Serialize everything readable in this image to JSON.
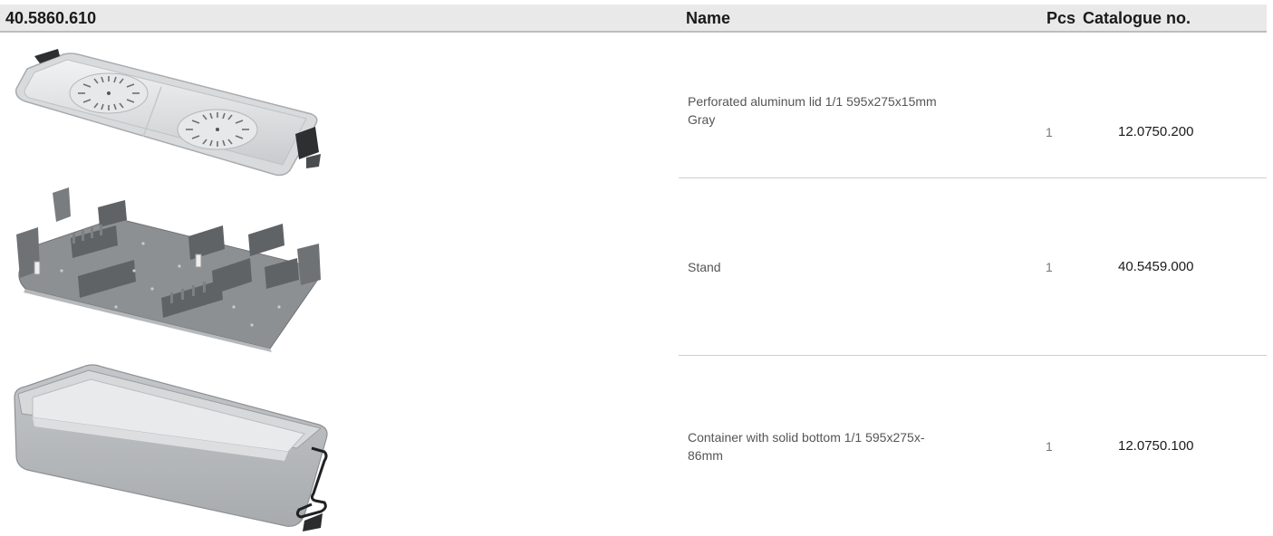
{
  "header": {
    "set_number": "40.5860.610",
    "name_label": "Name",
    "pcs_label": "Pcs",
    "catalogue_label": "Catalogue no."
  },
  "items": [
    {
      "name_line1": "Perforated aluminum lid 1/1 595x275x15mm",
      "name_line2": "Gray",
      "pcs": "1",
      "catalogue_no": "12.0750.200",
      "image": "perforated-lid-image"
    },
    {
      "name_line1": "Stand",
      "name_line2": "",
      "pcs": "1",
      "catalogue_no": "40.5459.000",
      "image": "instrument-stand-image"
    },
    {
      "name_line1": "Container with solid bottom 1/1 595x275x-",
      "name_line2": "86mm",
      "pcs": "1",
      "catalogue_no": "12.0750.100",
      "image": "container-image"
    }
  ],
  "colors": {
    "header_bg": "#e9e9e9",
    "divider": "#cfcfcf",
    "product_gray": "#b9bcc0",
    "product_dark": "#5f6366"
  }
}
